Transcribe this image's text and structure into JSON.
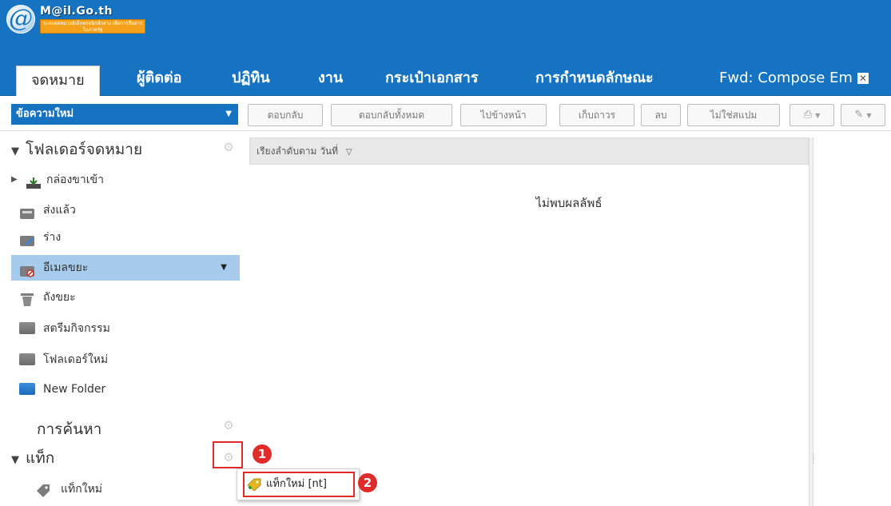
{
  "app": {
    "logo_title": "M@il.Go.th",
    "logo_subtitle": "ระบบจดหมายอิเล็กทรอนิกส์กลาง เพื่อการสื่อสารในภาครัฐ",
    "logo_symbol": "@"
  },
  "tabs": [
    {
      "label": "จดหมาย",
      "active": true
    },
    {
      "label": "ผู้ติดต่อ"
    },
    {
      "label": "ปฏิทิน"
    },
    {
      "label": "งาน"
    },
    {
      "label": "กระเป๋าเอกสาร"
    },
    {
      "label": "การกำหนดลักษณะ"
    },
    {
      "label": "Fwd: Compose Em",
      "close": "✕"
    }
  ],
  "toolbar": {
    "new_message": "ข้อความใหม่",
    "buttons": [
      "ตอบกลับ",
      "ตอบกลับทั้งหมด",
      "ไปข้างหน้า",
      "เก็บถาวร",
      "ลบ",
      "ไม่ใช่สแปม"
    ],
    "icons": [
      "print-icon",
      "tag-icon"
    ]
  },
  "sidebar": {
    "folders_header": "โฟลเดอร์จดหมาย",
    "folders": [
      {
        "label": "กล่องขาเข้า",
        "icon": "inbox-icon"
      },
      {
        "label": "ส่งแล้ว",
        "icon": "sent-icon"
      },
      {
        "label": "ร่าง",
        "icon": "drafts-icon"
      },
      {
        "label": "อีเมลขยะ",
        "icon": "junk-icon",
        "selected": true
      },
      {
        "label": "ถังขยะ",
        "icon": "trash-icon"
      },
      {
        "label": "สตรีมกิจกรรม",
        "icon": "folder-icon"
      },
      {
        "label": "โฟลเดอร์ใหม่",
        "icon": "folder-icon"
      },
      {
        "label": "New Folder",
        "icon": "folder-blue-icon"
      }
    ],
    "search_header": "การค้นหา",
    "tags_header": "แท็ก",
    "tags": [
      {
        "label": "แท็กใหม่",
        "icon": "tag-icon"
      }
    ]
  },
  "list": {
    "sort_label": "เรียงลำดับตาม วันที่",
    "empty_message": "ไม่พบผลลัพธ์"
  },
  "popup": {
    "new_tag_item": "แท็กใหม่ [nt]"
  },
  "callouts": [
    "1",
    "2"
  ],
  "colors": {
    "brand": "#1573c2",
    "selected": "#a6cbec",
    "callout": "#e02b2b",
    "logo_badge": "#f4a11c"
  }
}
